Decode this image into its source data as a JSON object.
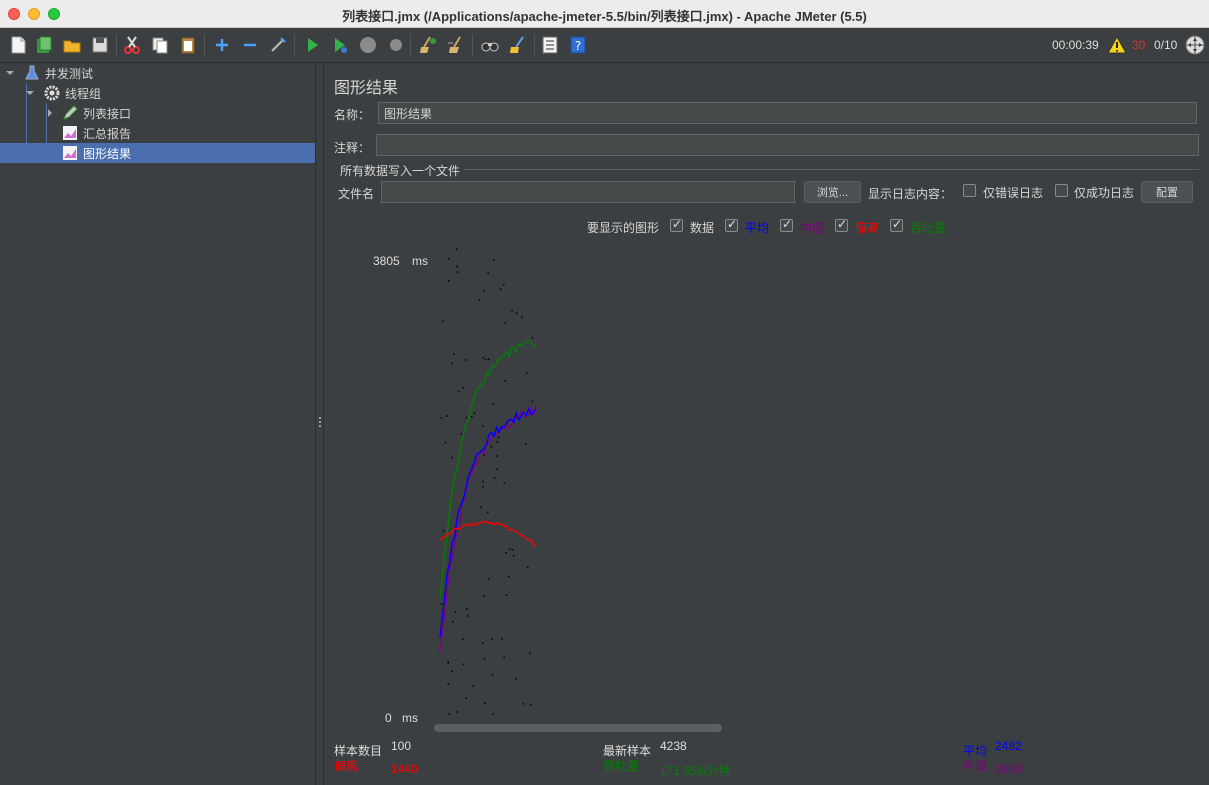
{
  "window": {
    "title": "列表接口.jmx (/Applications/apache-jmeter-5.5/bin/列表接口.jmx) - Apache JMeter (5.5)"
  },
  "toolbar": {
    "timer": "00:00:39",
    "error_count": "30",
    "threads": "0/10"
  },
  "tree": {
    "items": [
      {
        "label": "并发测试",
        "icon": "flask-icon"
      },
      {
        "label": "线程组",
        "icon": "gear-icon"
      },
      {
        "label": "列表接口",
        "icon": "pen-icon"
      },
      {
        "label": "汇总报告",
        "icon": "chart-icon"
      },
      {
        "label": "图形结果",
        "icon": "chart-icon"
      }
    ]
  },
  "panel": {
    "title": "图形结果",
    "name_label": "名称：",
    "name_value": "图形结果",
    "comment_label": "注释：",
    "comment_value": "",
    "file_group_title": "所有数据写入一个文件",
    "filename_label": "文件名",
    "filename_value": "",
    "browse_button": "浏览...",
    "log_content_label": "显示日志内容：",
    "errors_only_label": "仅错误日志",
    "success_only_label": "仅成功日志",
    "configure_button": "配置",
    "graphs_label": "要显示的图形",
    "legend": [
      {
        "label": "数据",
        "color": "#000000",
        "checked": true
      },
      {
        "label": "平均",
        "color": "#0000ff",
        "checked": true
      },
      {
        "label": "中值",
        "color": "#800080",
        "checked": true
      },
      {
        "label": "偏离",
        "color": "#ff0000",
        "checked": true
      },
      {
        "label": "吞吐量",
        "color": "#008000",
        "checked": true
      }
    ]
  },
  "graph": {
    "y_max_label": "3805",
    "y_min_label": "0",
    "unit": "ms"
  },
  "stats": {
    "sample_count_label": "样本数目",
    "sample_count_value": "100",
    "deviation_label": "偏离",
    "deviation_value": "1440",
    "latest_sample_label": "最新样本",
    "latest_sample_value": "4238",
    "throughput_label": "吞吐量",
    "throughput_value": "171.359/分钟",
    "average_label": "平均",
    "average_value": "2482",
    "median_label": "中值",
    "median_value": "2650"
  },
  "colors": {
    "data": "#000000",
    "average": "#0000ff",
    "median": "#800080",
    "deviation": "#ff0000",
    "throughput": "#008000"
  }
}
